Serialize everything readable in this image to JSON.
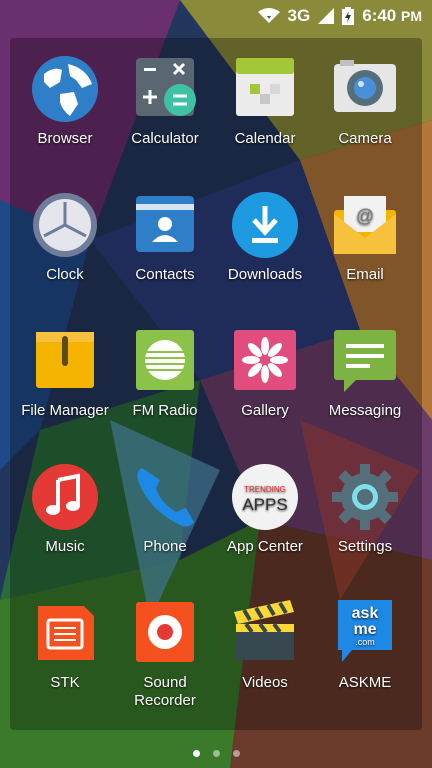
{
  "status": {
    "network": "3G",
    "time": "6:40",
    "ampm": "PM"
  },
  "apps": [
    {
      "label": "Browser"
    },
    {
      "label": "Calculator"
    },
    {
      "label": "Calendar"
    },
    {
      "label": "Camera"
    },
    {
      "label": "Clock"
    },
    {
      "label": "Contacts"
    },
    {
      "label": "Downloads"
    },
    {
      "label": "Email"
    },
    {
      "label": "File Manager"
    },
    {
      "label": "FM Radio"
    },
    {
      "label": "Gallery"
    },
    {
      "label": "Messaging"
    },
    {
      "label": "Music"
    },
    {
      "label": "Phone"
    },
    {
      "label": "App Center"
    },
    {
      "label": "Settings"
    },
    {
      "label": "STK"
    },
    {
      "label": "Sound Recorder"
    },
    {
      "label": "Videos"
    },
    {
      "label": "ASKME"
    }
  ],
  "appcenter_icon_text": {
    "top": "TRENDING",
    "main": "APPS"
  },
  "askme_icon_text": {
    "line1": "ask",
    "line2": "me",
    "line3": ".com"
  },
  "pager": {
    "pages": 3,
    "current": 1
  }
}
